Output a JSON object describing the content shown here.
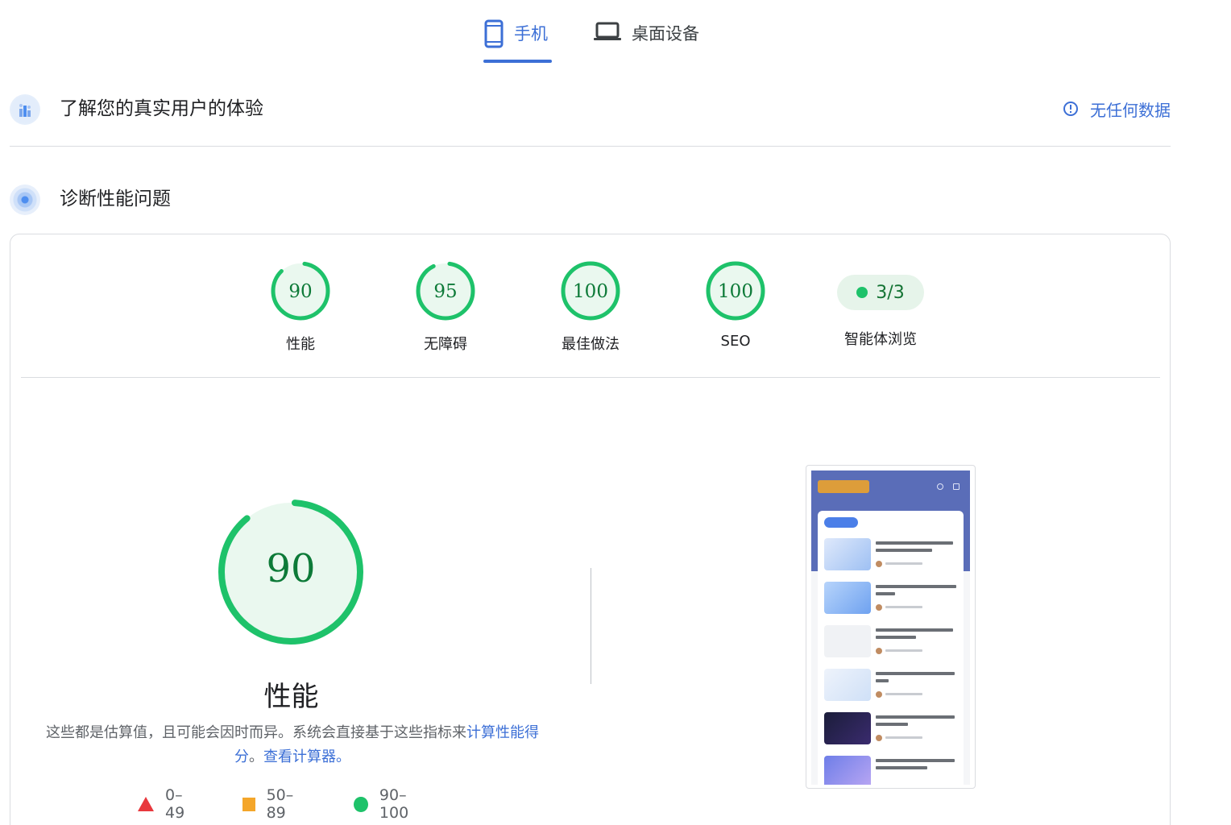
{
  "tabs": {
    "mobile_label": "手机",
    "desktop_label": "桌面设备"
  },
  "crux": {
    "title": "了解您的真实用户的体验",
    "no_data": "无任何数据"
  },
  "diagnose": {
    "title": "诊断性能问题"
  },
  "scores": [
    {
      "label": "性能",
      "score": 90,
      "fraction": 0.9
    },
    {
      "label": "无障碍",
      "score": 95,
      "fraction": 0.95
    },
    {
      "label": "最佳做法",
      "score": 100,
      "fraction": 1.0
    },
    {
      "label": "SEO",
      "score": 100,
      "fraction": 1.0
    }
  ],
  "agent": {
    "value": "3/3",
    "label": "智能体浏览"
  },
  "performance": {
    "score": "90",
    "fraction": 0.9,
    "title": "性能",
    "desc_text": "这些都是估算值，且可能会因时而异。系统会直接基于这些指标来",
    "link1": "计算性能得分",
    "sep": "。",
    "link2": "查看计算器。"
  },
  "legend": [
    {
      "range": "0–49",
      "shape": "triangle",
      "color": "#e8383d"
    },
    {
      "range": "50–89",
      "shape": "square",
      "color": "#f4a62a"
    },
    {
      "range": "90–100",
      "shape": "circle",
      "color": "#1ec26a"
    }
  ],
  "colors": {
    "accent": "#3c6fd6",
    "pass": "#1ec26a",
    "pass_bg": "#e8f7ee",
    "score_text": "#0d7a38"
  }
}
